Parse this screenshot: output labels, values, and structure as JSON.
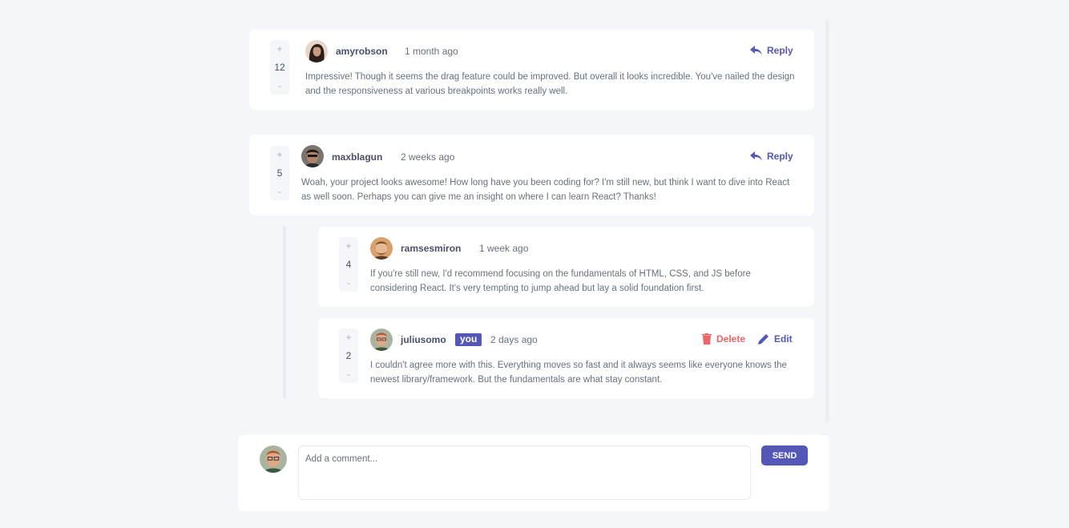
{
  "colors": {
    "background": "#f5f6fa",
    "card": "#ffffff",
    "accent": "#5457b6",
    "danger": "#ed6468",
    "username": "#4a4f6a",
    "text": "#67727e"
  },
  "comments": [
    {
      "username": "amyrobson",
      "time": "1 month ago",
      "score": "12",
      "reply_label": "Reply",
      "content": "Impressive! Though it seems the drag feature could be improved. But overall it looks incredible. You've nailed the design and the responsiveness at various breakpoints works really well."
    },
    {
      "username": "maxblagun",
      "time": "2 weeks ago",
      "score": "5",
      "reply_label": "Reply",
      "content": "Woah, your project looks awesome! How long have you been coding for? I'm still new, but think I want to dive into React as well soon. Perhaps you can give me an insight on where I can learn React? Thanks!"
    }
  ],
  "replies": [
    {
      "username": "ramsesmiron",
      "time": "1 week ago",
      "score": "4",
      "content": "If you're still new, I'd recommend focusing on the fundamentals of HTML, CSS, and JS before considering React. It's very tempting to jump ahead but lay a solid foundation first."
    },
    {
      "username": "juliusomo",
      "badge": "you",
      "time": "2 days ago",
      "score": "2",
      "delete_label": "Delete",
      "edit_label": "Edit",
      "content": "I couldn't agree more with this. Everything moves so fast and it always seems like everyone knows the newest library/framework. But the fundamentals are what stay constant."
    }
  ],
  "vote": {
    "plus": "+",
    "minus": "-"
  },
  "compose": {
    "placeholder": "Add a comment...",
    "send_label": "SEND"
  }
}
